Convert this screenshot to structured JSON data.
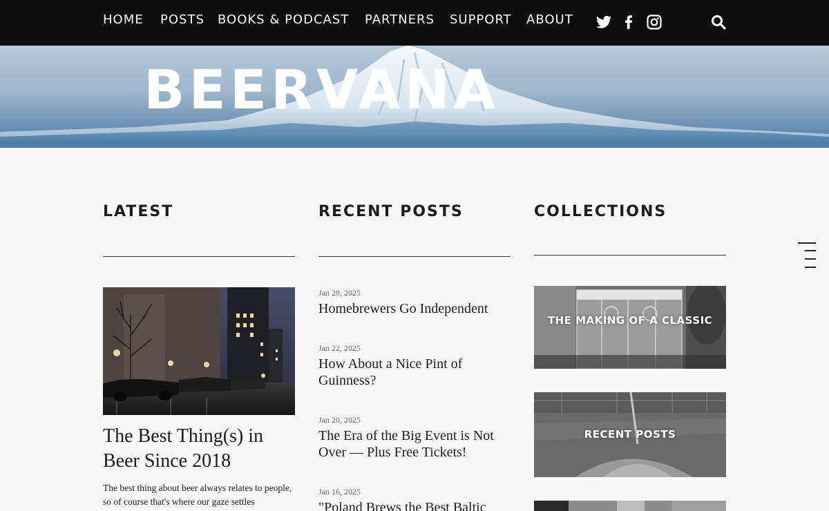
{
  "nav": {
    "items": [
      "HOME",
      "POSTS",
      "BOOKS & PODCAST",
      "PARTNERS",
      "SUPPORT",
      "ABOUT"
    ],
    "social_icons": [
      "twitter-icon",
      "facebook-icon",
      "instagram-icon"
    ],
    "search_icon": "search-icon"
  },
  "hero": {
    "title": "BEERVANA"
  },
  "latest": {
    "heading": "LATEST",
    "title": "The Best Thing(s) in Beer Since 2018",
    "excerpt": "The best thing about beer always relates to people, so of course that's where our gaze settles"
  },
  "recent": {
    "heading": "RECENT POSTS",
    "posts": [
      {
        "date": "Jan 28, 2025",
        "title": "Homebrewers Go Independent"
      },
      {
        "date": "Jan 22, 2025",
        "title": "How About a Nice Pint of Guinness?"
      },
      {
        "date": "Jan 20, 2025",
        "title": "The Era of the Big Event is Not Over — Plus Free Tickets!"
      },
      {
        "date": "Jan 16, 2025",
        "title": "\"Poland Brews the Best Baltic"
      }
    ]
  },
  "collections": {
    "heading": "COLLECTIONS",
    "items": [
      {
        "label": "THE MAKING OF A CLASSIC"
      },
      {
        "label": "RECENT POSTS"
      }
    ]
  },
  "colors": {
    "nav_bg": "#0d0d0d",
    "page_bg": "#f8f8f8",
    "text": "#1c1c1c"
  }
}
